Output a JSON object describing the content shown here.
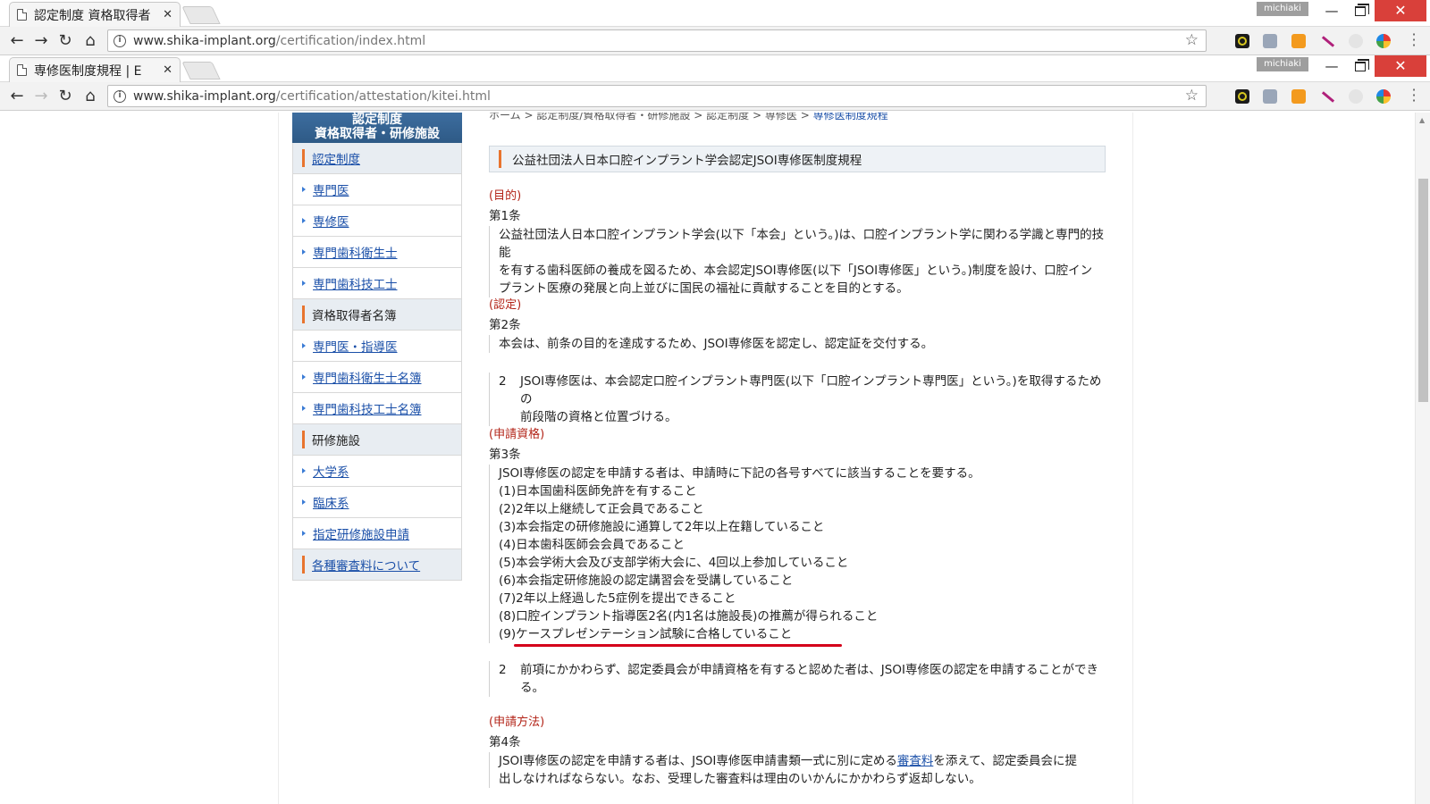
{
  "browser": {
    "window1": {
      "tab_title": "認定制度 資格取得者",
      "url_host": "www.shika-implant.org",
      "url_path": "/certification/index.html",
      "profile": "michiaki"
    },
    "window2": {
      "tab_title": "専修医制度規程 | E",
      "url_host": "www.shika-implant.org",
      "url_path": "/certification/attestation/kitei.html",
      "profile": "michiaki"
    }
  },
  "breadcrumb": {
    "items": [
      "ホーム",
      "認定制度/資格取得者・研修施設",
      "認定制度",
      "専修医"
    ],
    "current": "専修医制度規程",
    "sep": ">"
  },
  "sidebar": {
    "header_line1": "認定制度",
    "header_line2": "資格取得者・研修施設",
    "items": [
      {
        "label": "認定制度",
        "kind": "section",
        "link": true
      },
      {
        "label": "専門医",
        "kind": "item",
        "link": true
      },
      {
        "label": "専修医",
        "kind": "item",
        "link": true
      },
      {
        "label": "専門歯科衛生士",
        "kind": "item",
        "link": true
      },
      {
        "label": "専門歯科技工士",
        "kind": "item",
        "link": true
      },
      {
        "label": "資格取得者名簿",
        "kind": "section",
        "link": false
      },
      {
        "label": "専門医・指導医",
        "kind": "item",
        "link": true
      },
      {
        "label": "専門歯科衛生士名簿",
        "kind": "item",
        "link": true
      },
      {
        "label": "専門歯科技工士名簿",
        "kind": "item",
        "link": true
      },
      {
        "label": "研修施設",
        "kind": "section",
        "link": false
      },
      {
        "label": "大学系",
        "kind": "item",
        "link": true
      },
      {
        "label": "臨床系",
        "kind": "item",
        "link": true
      },
      {
        "label": "指定研修施設申請",
        "kind": "item",
        "link": true
      },
      {
        "label": "各種審査料について",
        "kind": "section",
        "link": true
      }
    ]
  },
  "main": {
    "title": "公益社団法人日本口腔インプラント学会認定JSOI専修医制度規程",
    "a1": {
      "head": "(目的)",
      "no": "第1条",
      "l1": "公益社団法人日本口腔インプラント学会(以下「本会」という。)は、口腔インプラント学に関わる学識と専門的技能",
      "l2": "を有する歯科医師の養成を図るため、本会認定JSOI専修医(以下「JSOI専修医」という。)制度を設け、口腔イン",
      "l3": "プラント医療の発展と向上並びに国民の福祉に貢献することを目的とする。"
    },
    "a2": {
      "head": "(認定)",
      "no": "第2条",
      "body": "本会は、前条の目的を達成するため、JSOI専修医を認定し、認定証を交付する。",
      "p2_no": "2",
      "p2_l1": "JSOI専修医は、本会認定口腔インプラント専門医(以下「口腔インプラント専門医」という。)を取得するための",
      "p2_l2": "前段階の資格と位置づける。"
    },
    "a3": {
      "head": "(申請資格)",
      "no": "第3条",
      "intro": "JSOI専修医の認定を申請する者は、申請時に下記の各号すべてに該当することを要する。",
      "items": [
        "(1)日本国歯科医師免許を有すること",
        "(2)2年以上継続して正会員であること",
        "(3)本会指定の研修施設に通算して2年以上在籍していること",
        "(4)日本歯科医師会会員であること",
        "(5)本会学術大会及び支部学術大会に、4回以上参加していること",
        "(6)本会指定研修施設の認定講習会を受講していること",
        "(7)2年以上経過した5症例を提出できること",
        "(8)口腔インプラント指導医2名(内1名は施設長)の推薦が得られること"
      ],
      "item9_prefix": "(9)",
      "item9_text": "ケースプレゼンテーション試験に合格していること",
      "p2_no": "2",
      "p2_l1": "前項にかかわらず、認定委員会が申請資格を有すると認めた者は、JSOI専修医の認定を申請することができ",
      "p2_l2": "る。"
    },
    "a4": {
      "head": "(申請方法)",
      "no": "第4条",
      "l1_pre": "JSOI専修医の認定を申請する者は、JSOI専修医申請書類一式に別に定める",
      "l1_link": "審査料",
      "l1_post": "を添えて、認定委員会に提",
      "l2": "出しなければならない。なお、受理した審査料は理由のいかんにかかわらず返却しない。"
    }
  },
  "colors": {
    "accent_orange": "#e8742e",
    "heading_red": "#b32418",
    "link_blue": "#1a4fa8",
    "sidebar_header": "#2e5a86",
    "underline_red": "#d4001a"
  }
}
